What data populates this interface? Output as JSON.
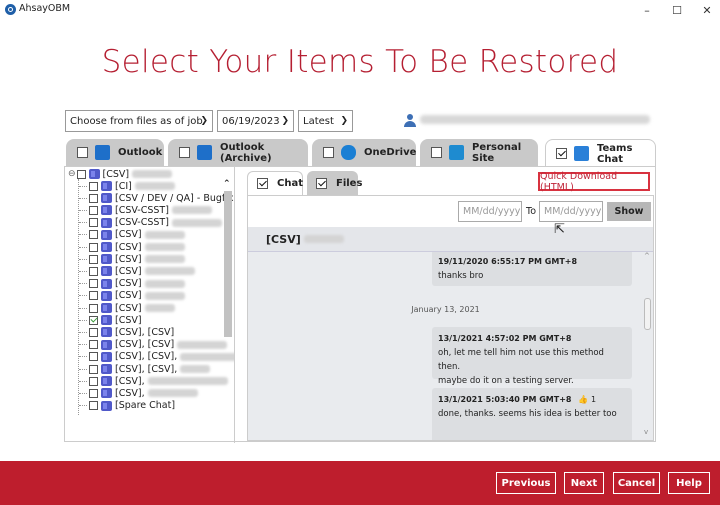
{
  "window": {
    "app_title": "AhsayOBM",
    "controls": {
      "minimize": "–",
      "maximize": "☐",
      "close": "✕"
    }
  },
  "heading": "Select Your Items To Be Restored",
  "filters": {
    "source_select": "Choose from files as of job",
    "date_select": "06/19/2023",
    "version_select": "Latest"
  },
  "user": {
    "icon": "user-icon",
    "email": "(redacted)"
  },
  "service_tabs": [
    {
      "label": "Outlook",
      "checked": false,
      "icon": "outlook-icon",
      "color": "#1e6fc9"
    },
    {
      "label": "Outlook (Archive)",
      "checked": false,
      "icon": "outlook-archive-icon",
      "color": "#1e6fc9"
    },
    {
      "label": "OneDrive",
      "checked": false,
      "icon": "onedrive-icon",
      "color": "#1a7fd4"
    },
    {
      "label": "Personal Site",
      "checked": false,
      "icon": "sharepoint-icon",
      "color": "#1e8bd0"
    },
    {
      "label": "Teams Chat",
      "checked": true,
      "icon": "teams-icon",
      "color": "#2a80d8",
      "active": true
    }
  ],
  "tree": {
    "root": {
      "label": "[CSV]",
      "checked": false
    },
    "items": [
      {
        "label": "[CI]",
        "checked": false
      },
      {
        "label": "[CSV / DEV / QA] - Bugfix We",
        "checked": false
      },
      {
        "label": "[CSV-CSST]",
        "checked": false
      },
      {
        "label": "[CSV-CSST]",
        "checked": false
      },
      {
        "label": "[CSV]",
        "checked": false
      },
      {
        "label": "[CSV]",
        "checked": false
      },
      {
        "label": "[CSV]",
        "checked": false
      },
      {
        "label": "[CSV]",
        "checked": false
      },
      {
        "label": "[CSV]",
        "checked": false
      },
      {
        "label": "[CSV]",
        "checked": false
      },
      {
        "label": "[CSV]",
        "checked": false
      },
      {
        "label": "[CSV]",
        "checked": true
      },
      {
        "label": "[CSV], [CSV]",
        "checked": false
      },
      {
        "label": "[CSV], [CSV]",
        "checked": false
      },
      {
        "label": "[CSV], [CSV],",
        "checked": false
      },
      {
        "label": "[CSV], [CSV],",
        "checked": false
      },
      {
        "label": "[CSV],",
        "checked": false
      },
      {
        "label": "[CSV],",
        "checked": false
      },
      {
        "label": "[Spare Chat]",
        "checked": false
      }
    ]
  },
  "content_tabs": [
    {
      "label": "Chat",
      "checked": true
    },
    {
      "label": "Files",
      "checked": true
    }
  ],
  "quick_download_label": "Quick Download (HTML)",
  "date_range": {
    "from_placeholder": "MM/dd/yyyy",
    "to_label": "To",
    "to_placeholder": "MM/dd/yyyy",
    "show_label": "Show"
  },
  "chat": {
    "title": "[CSV]",
    "messages": [
      {
        "timestamp": "19/11/2020 6:55:17 PM GMT+8",
        "text": [
          "thanks bro"
        ]
      },
      {
        "day_separator": "January 13, 2021"
      },
      {
        "timestamp": "13/1/2021 4:57:02 PM GMT+8",
        "text": [
          "oh, let me tell him not use this method then.",
          "maybe do it on a testing server."
        ]
      },
      {
        "timestamp": "13/1/2021 5:03:40 PM GMT+8",
        "reaction": "👍",
        "reaction_count": "1",
        "text": [
          "done, thanks. seems his idea is better too"
        ]
      }
    ]
  },
  "footer": {
    "previous": "Previous",
    "next": "Next",
    "cancel": "Cancel",
    "help": "Help",
    "color": "#be1e2d"
  }
}
